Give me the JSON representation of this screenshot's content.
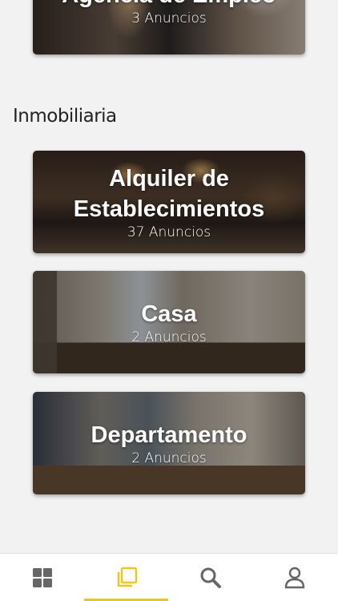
{
  "categories": {
    "empleo": {
      "title": "Agencia de Empleo",
      "count": "3 Anuncios"
    },
    "section_title": "Inmobiliaria",
    "items": [
      {
        "title_line1": "Alquiler de",
        "title_line2": "Establecimientos",
        "count": "37 Anuncios"
      },
      {
        "title": "Casa",
        "count": "2 Anuncios"
      },
      {
        "title": "Departamento",
        "count": "2 Anuncios"
      }
    ]
  },
  "tabbar": {
    "tabs": [
      {
        "icon": "grid-icon",
        "active": false
      },
      {
        "icon": "pages-icon",
        "active": true
      },
      {
        "icon": "search-icon",
        "active": false
      },
      {
        "icon": "user-icon",
        "active": false
      }
    ],
    "colors": {
      "active": "#f0c419",
      "inactive": "#666666",
      "indicator": "#f0c419"
    }
  }
}
